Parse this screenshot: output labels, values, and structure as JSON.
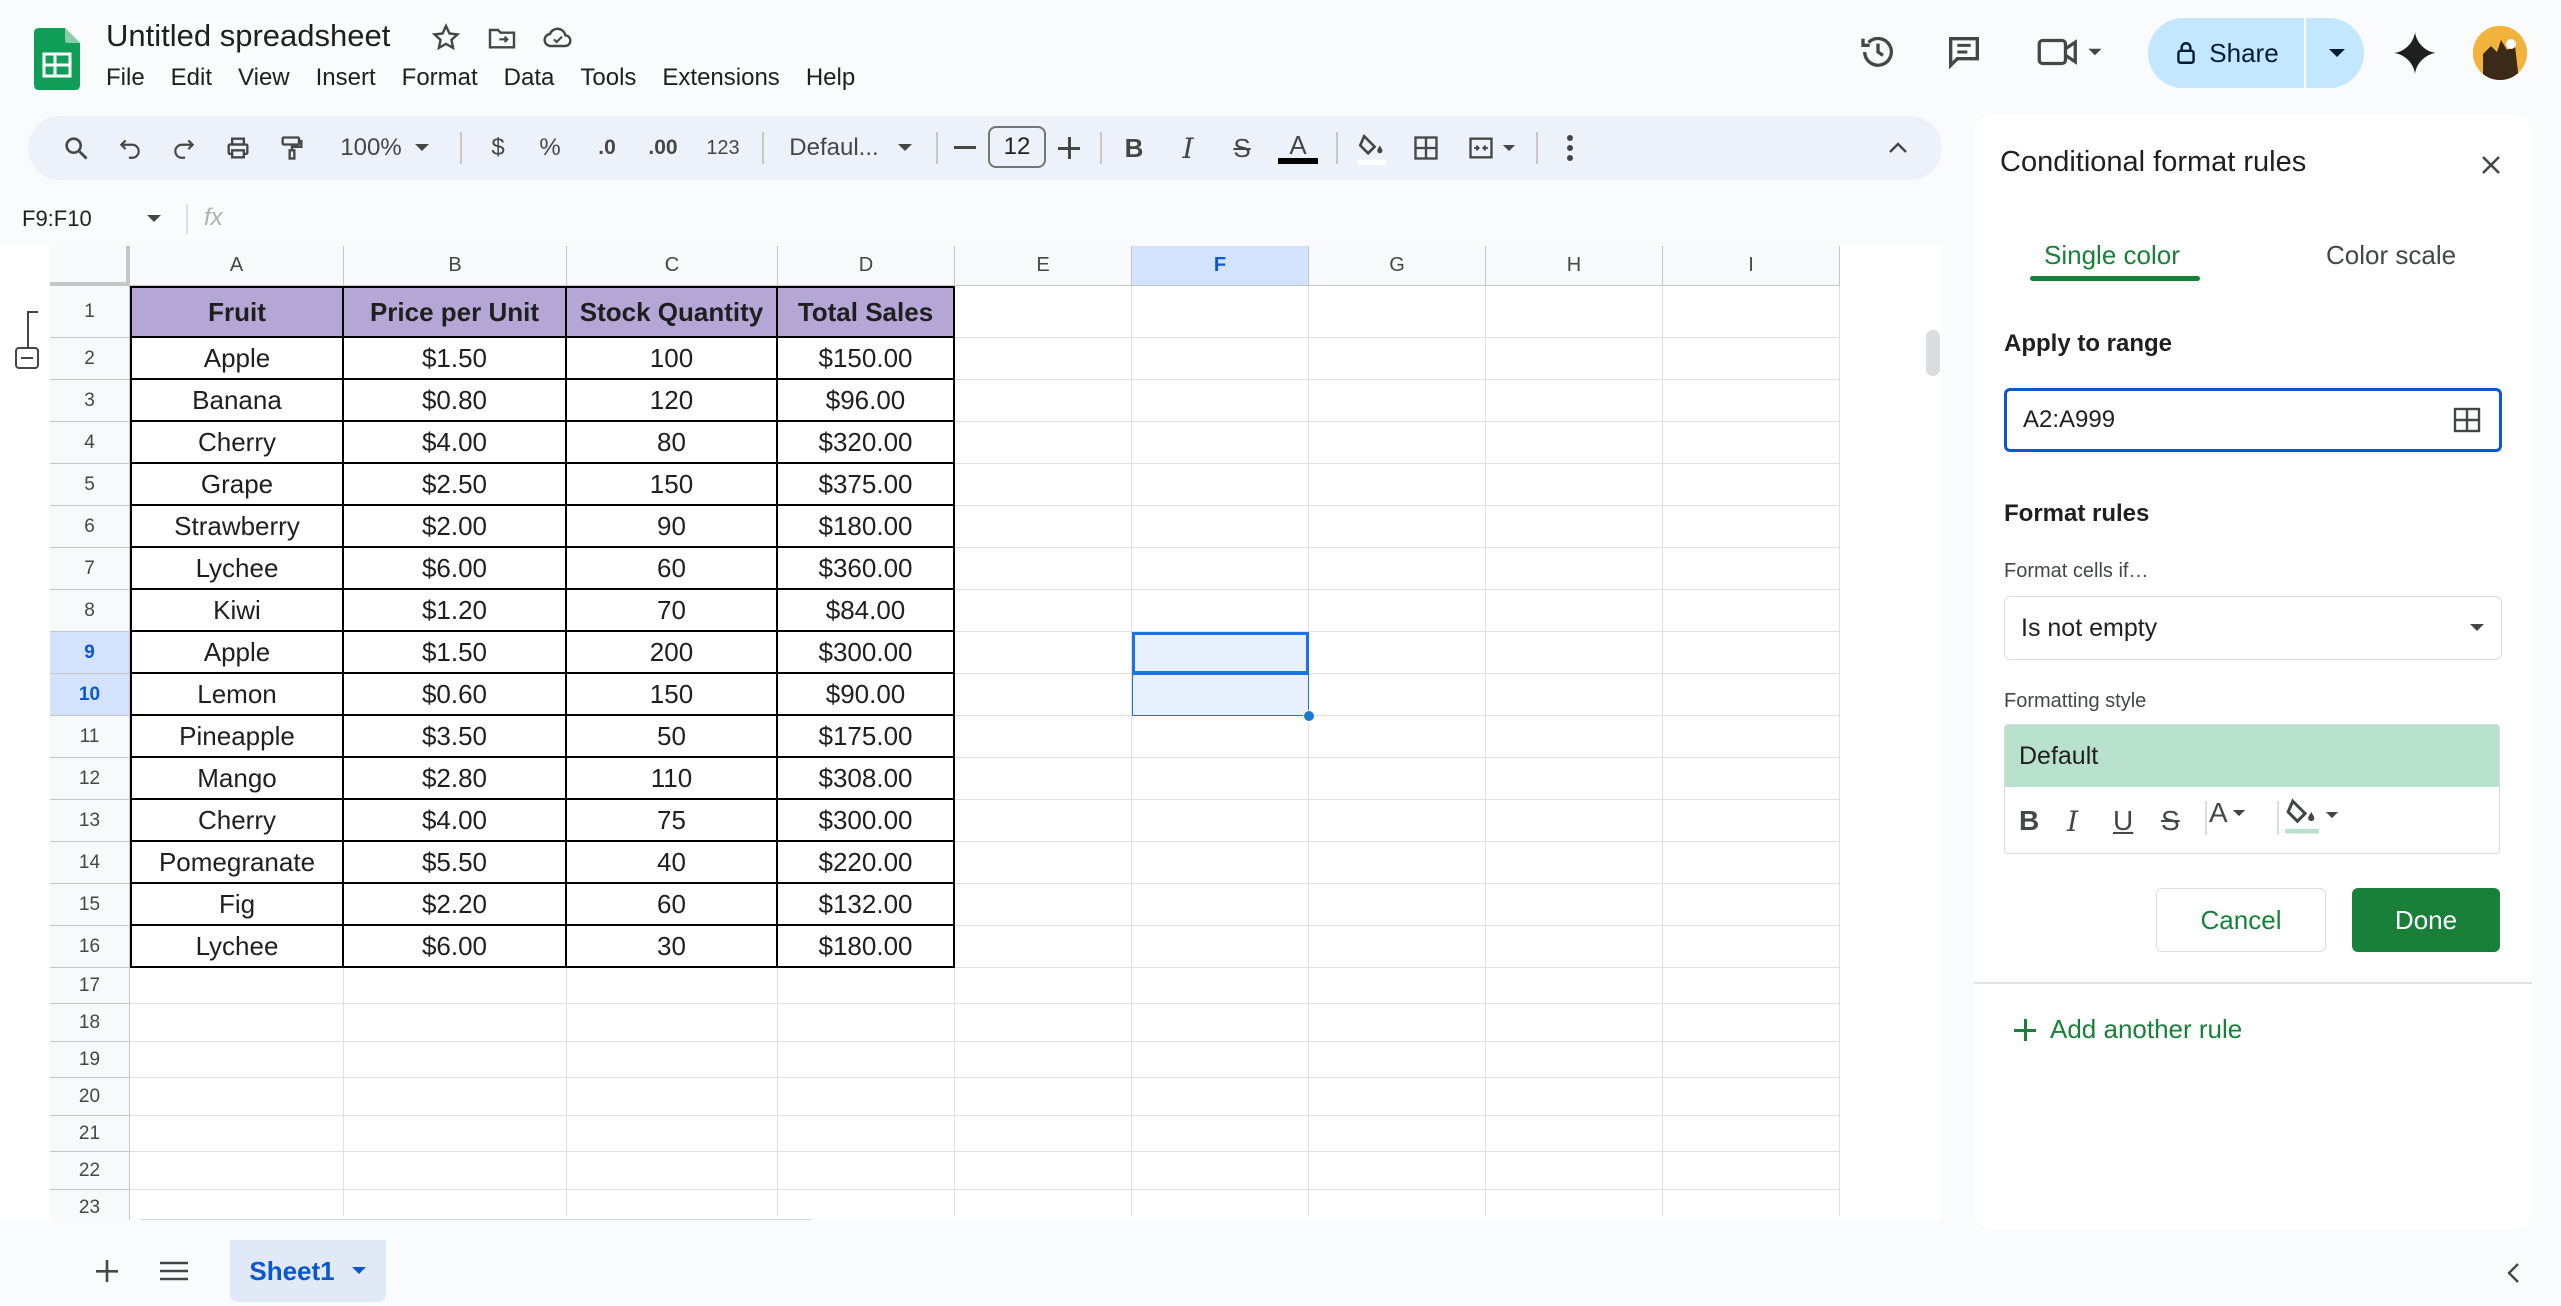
{
  "header": {
    "title": "Untitled spreadsheet",
    "menu": [
      "File",
      "Edit",
      "View",
      "Insert",
      "Format",
      "Data",
      "Tools",
      "Extensions",
      "Help"
    ],
    "share_label": "Share"
  },
  "toolbar": {
    "zoom": "100%",
    "currency": "$",
    "percent": "%",
    "decrease_decimal": ".0",
    "increase_decimal": ".00",
    "number_format": "123",
    "font": "Defaul...",
    "font_size": "12",
    "bold": "B",
    "italic": "I",
    "strike": "S",
    "text_color": "A"
  },
  "formula_bar": {
    "name_box": "F9:F10",
    "fx": "fx"
  },
  "grid": {
    "columns": [
      "A",
      "B",
      "C",
      "D",
      "E",
      "F",
      "G",
      "H",
      "I"
    ],
    "row_numbers": [
      "1",
      "2",
      "3",
      "4",
      "5",
      "6",
      "7",
      "8",
      "9",
      "10",
      "11",
      "12",
      "13",
      "14",
      "15",
      "16",
      "17",
      "18",
      "19",
      "20",
      "21",
      "22",
      "23"
    ],
    "headers": [
      "Fruit",
      "Price per Unit",
      "Stock Quantity",
      "Total Sales"
    ],
    "rows": [
      [
        "Apple",
        "$1.50",
        "100",
        "$150.00"
      ],
      [
        "Banana",
        "$0.80",
        "120",
        "$96.00"
      ],
      [
        "Cherry",
        "$4.00",
        "80",
        "$320.00"
      ],
      [
        "Grape",
        "$2.50",
        "150",
        "$375.00"
      ],
      [
        "Strawberry",
        "$2.00",
        "90",
        "$180.00"
      ],
      [
        "Lychee",
        "$6.00",
        "60",
        "$360.00"
      ],
      [
        "Kiwi",
        "$1.20",
        "70",
        "$84.00"
      ],
      [
        "Apple",
        "$1.50",
        "200",
        "$300.00"
      ],
      [
        "Lemon",
        "$0.60",
        "150",
        "$90.00"
      ],
      [
        "Pineapple",
        "$3.50",
        "50",
        "$175.00"
      ],
      [
        "Mango",
        "$2.80",
        "110",
        "$308.00"
      ],
      [
        "Cherry",
        "$4.00",
        "75",
        "$300.00"
      ],
      [
        "Pomegranate",
        "$5.50",
        "40",
        "$220.00"
      ],
      [
        "Fig",
        "$2.20",
        "60",
        "$132.00"
      ],
      [
        "Lychee",
        "$6.00",
        "30",
        "$180.00"
      ]
    ],
    "header_color": "#b4a7d6",
    "selected_column": "F"
  },
  "panel": {
    "title": "Conditional format rules",
    "tabs": [
      "Single color",
      "Color scale"
    ],
    "apply_label": "Apply to range",
    "range_value": "A2:A999",
    "format_rules_label": "Format rules",
    "format_cells_if_label": "Format cells if…",
    "condition": "Is not empty",
    "formatting_style_label": "Formatting style",
    "style_preview": "Default",
    "style_buttons": [
      "B",
      "I",
      "U",
      "S",
      "A"
    ],
    "cancel_label": "Cancel",
    "done_label": "Done",
    "add_rule_label": "Add another rule",
    "accent_color": "#188038"
  },
  "bottom": {
    "sheet_name": "Sheet1"
  }
}
